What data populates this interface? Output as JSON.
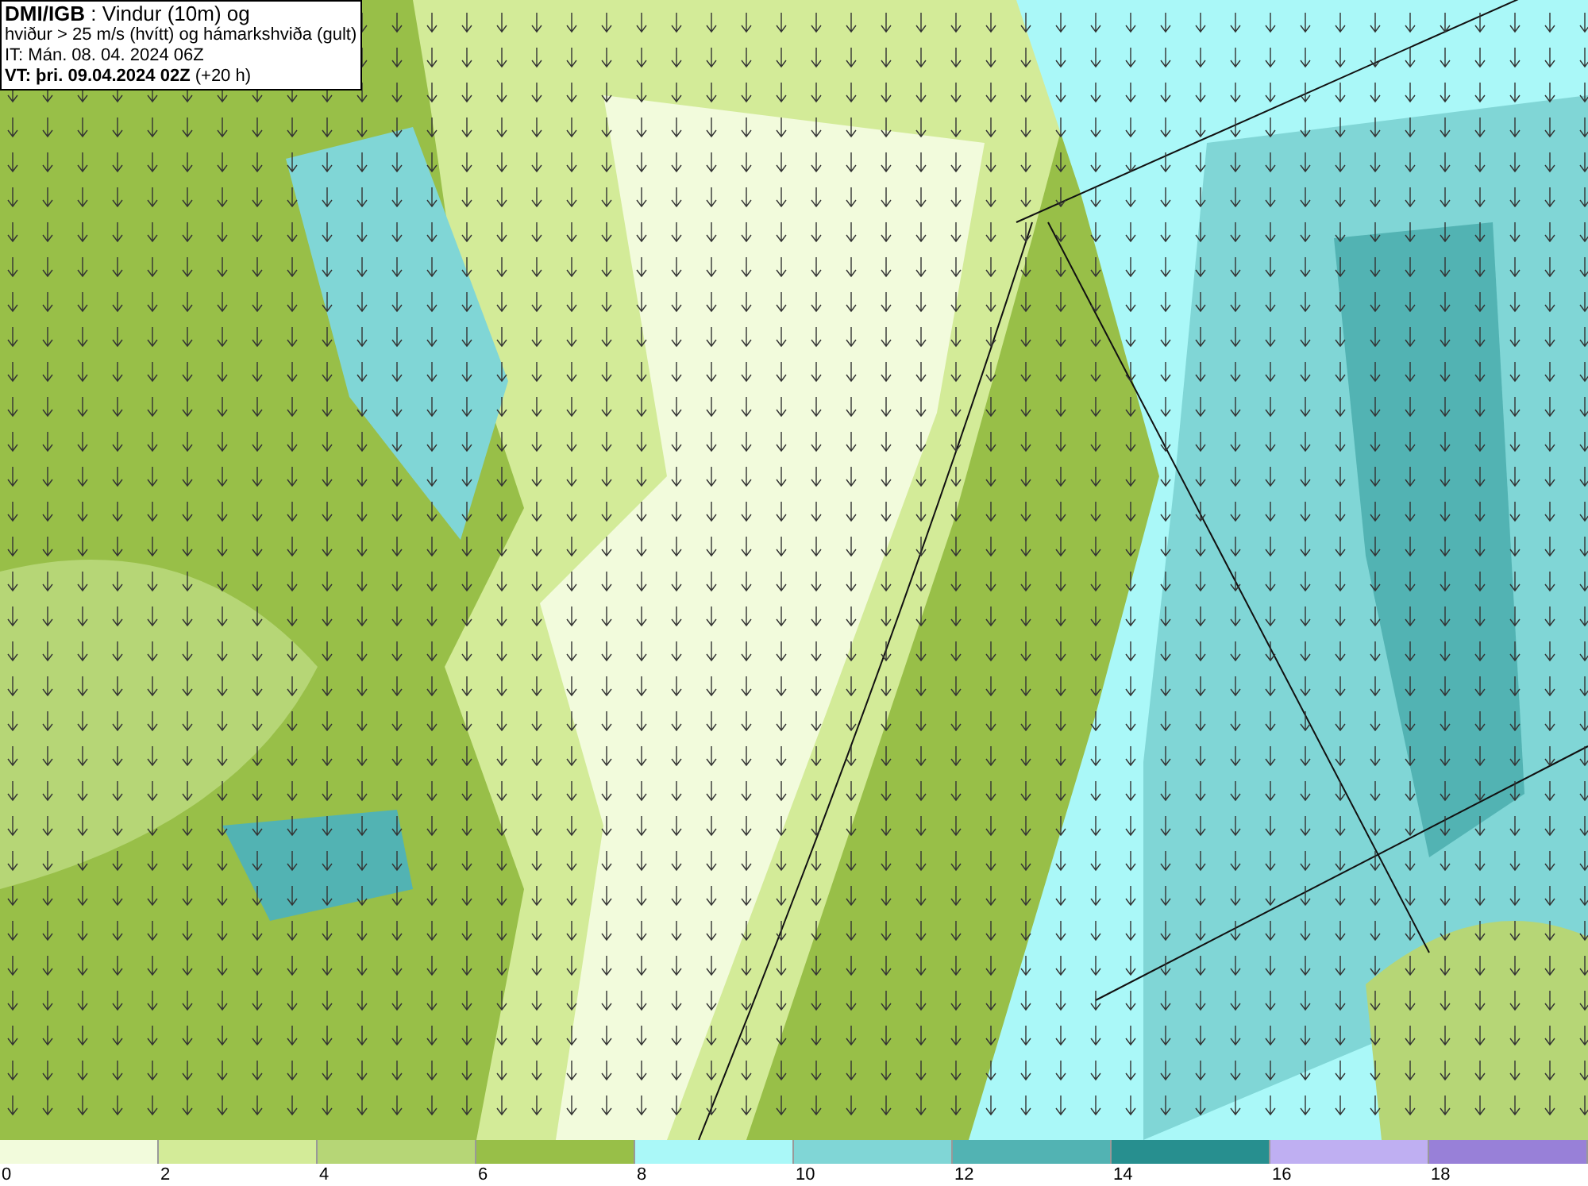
{
  "info_box": {
    "lines": [
      "**DMI/IGB** : Vindur (10m) og",
      "hviður > 25 m/s (hvítt) og hámarkshviða (gult)",
      "IT: Mán. 08. 04. 2024 06Z",
      "**VT: þri. 09.04.2024 02Z** (+20 h)"
    ]
  },
  "legend": [
    {
      "label": "0",
      "color": "#f2fbdc"
    },
    {
      "label": "2",
      "color": "#d3eb98"
    },
    {
      "label": "4",
      "color": "#b6d676"
    },
    {
      "label": "6",
      "color": "#98bf48"
    },
    {
      "label": "8",
      "color": "#aaf8f8"
    },
    {
      "label": "10",
      "color": "#80d6d6"
    },
    {
      "label": "12",
      "color": "#52b3b3"
    },
    {
      "label": "14",
      "color": "#278f8f"
    },
    {
      "label": "16",
      "color": "#bfaff2"
    },
    {
      "label": "18",
      "color": "#9880d8"
    }
  ]
}
